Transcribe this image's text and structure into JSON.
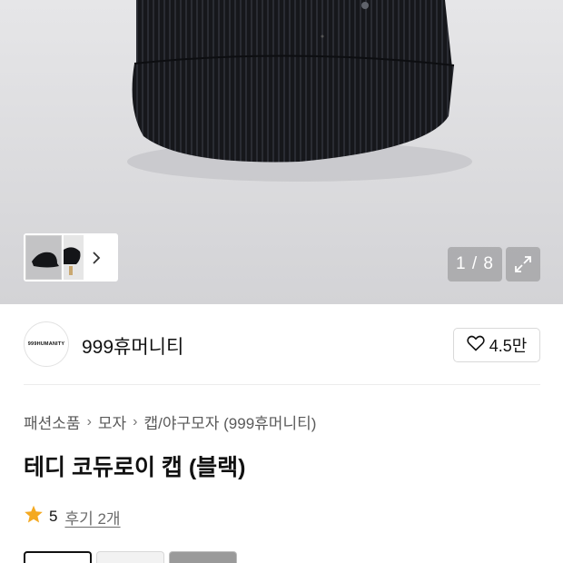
{
  "gallery": {
    "counter": "1 / 8",
    "next_icon": "chevron-right-icon",
    "expand_icon": "expand-arrows-icon"
  },
  "store": {
    "logo_text": "999HUMANITY",
    "name": "999휴머니티",
    "likes": "4.5만",
    "like_icon": "heart-outline-icon"
  },
  "breadcrumb": [
    "패션소품",
    "모자",
    "캡/야구모자 (999휴머니티)"
  ],
  "product": {
    "title": "테디 코듀로이 캡 (블랙)",
    "rating": "5",
    "reviews": "후기 2개"
  },
  "colors": {
    "star": "#f4a921",
    "hero_bg": "#dcdcde",
    "cap": "#17181c"
  }
}
